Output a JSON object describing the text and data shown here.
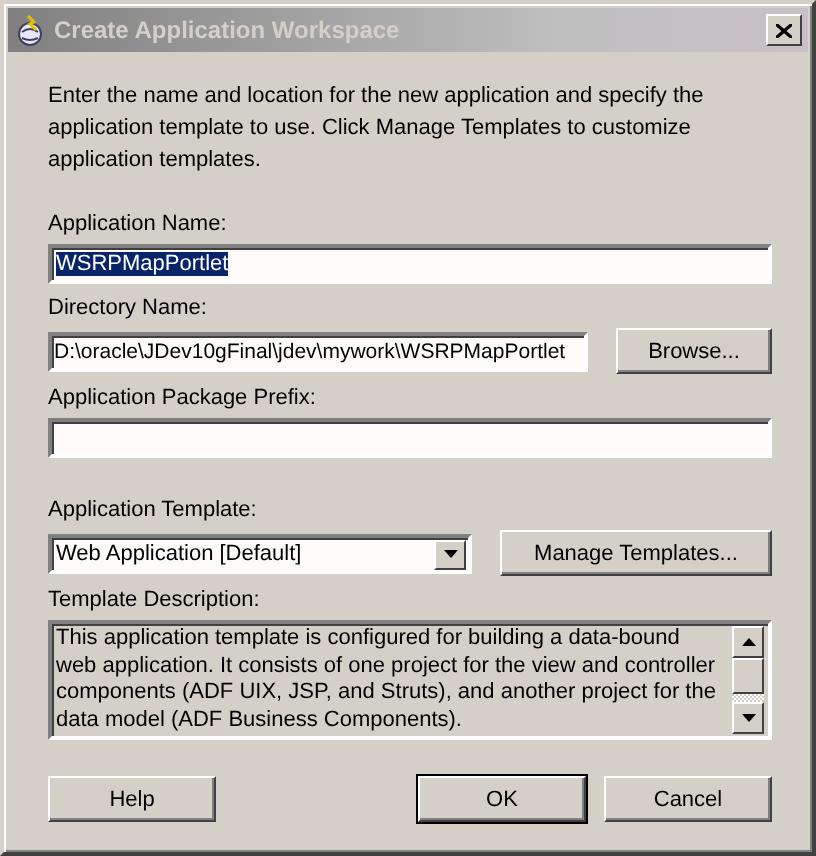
{
  "window": {
    "title": "Create Application Workspace",
    "active": false
  },
  "intro": "Enter the name and location for the new application and specify the application template to use. Click Manage Templates to customize application templates.",
  "fields": [
    {
      "kind": "text",
      "label": "Application Name:",
      "value": "WSRPMapPortlet",
      "text_selected": true
    },
    {
      "kind": "text_button",
      "label": "Directory Name:",
      "value": "D:\\oracle\\JDev10gFinal\\jdev\\mywork\\WSRPMapPortlet",
      "button": "Browse..."
    },
    {
      "kind": "text",
      "label": "Application Package Prefix:"
    },
    {
      "kind": "combo_button",
      "label": "Application Template:",
      "value": "Web Application [Default]",
      "button": "Manage Templates..."
    },
    {
      "kind": "memo",
      "label": "Template Description:",
      "value": "This application template is configured for building a data-bound web application. It consists of one project for the view and controller components (ADF UIX, JSP, and Struts), and another project for the data model (ADF Business Components)."
    }
  ],
  "buttons": [
    {
      "label": "Help",
      "default": false
    },
    {
      "label": "OK",
      "default": true
    },
    {
      "label": "Cancel",
      "default": false
    }
  ]
}
